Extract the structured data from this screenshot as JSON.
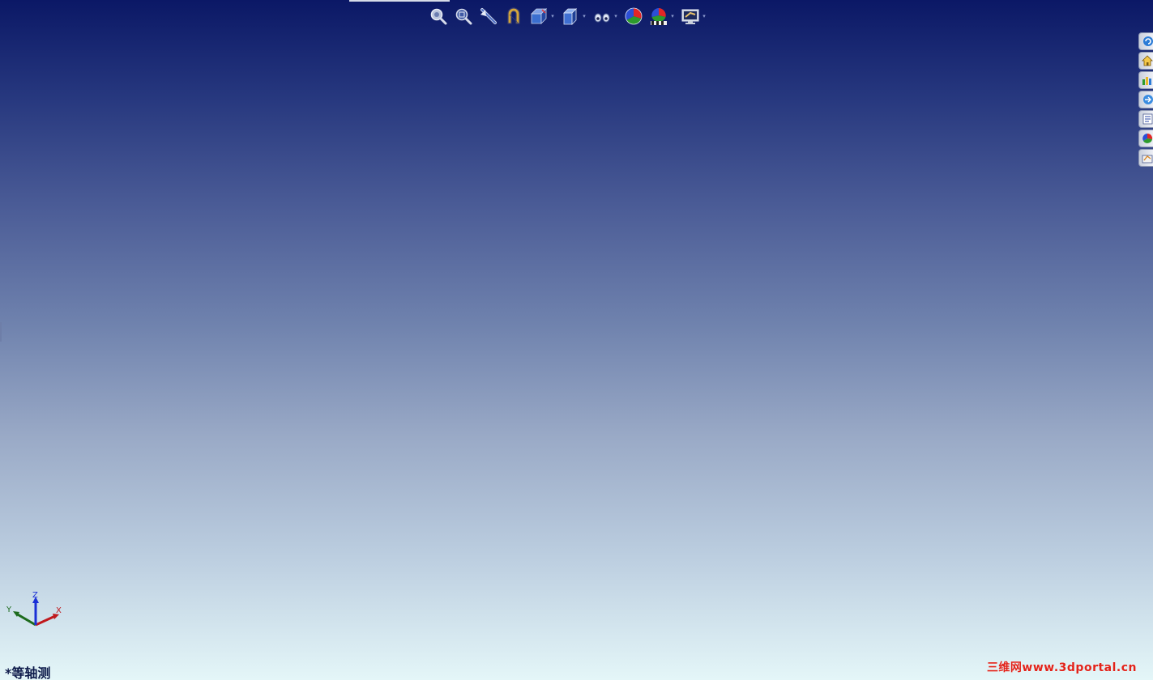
{
  "viewport": {
    "view_orientation_label": "*等轴测",
    "triad": {
      "x_label": "X",
      "y_label": "Y",
      "z_label": "Z"
    }
  },
  "watermark": {
    "text": "三维网www.3dportal.cn"
  },
  "colors": {
    "background_top": "#0b1866",
    "background_bottom": "#e4f6f8",
    "axis_x": "#c0191d",
    "axis_y": "#1d6b1d",
    "axis_z": "#1a2fd6",
    "watermark": "#e2231a"
  },
  "heads_up_toolbar": {
    "icons": [
      "zoom-to-fit-icon",
      "zoom-to-area-icon",
      "previous-view-icon",
      "section-view-icon",
      "view-orientation-icon",
      "display-style-icon",
      "hide-show-items-icon",
      "edit-appearance-icon",
      "apply-scene-icon",
      "view-settings-icon"
    ]
  },
  "task_pane": {
    "icons": [
      "solidworks-resources-icon",
      "design-library-icon",
      "file-explorer-icon",
      "view-palette-icon",
      "search-results-icon",
      "appearances-scenes-icon",
      "custom-properties-icon"
    ]
  }
}
